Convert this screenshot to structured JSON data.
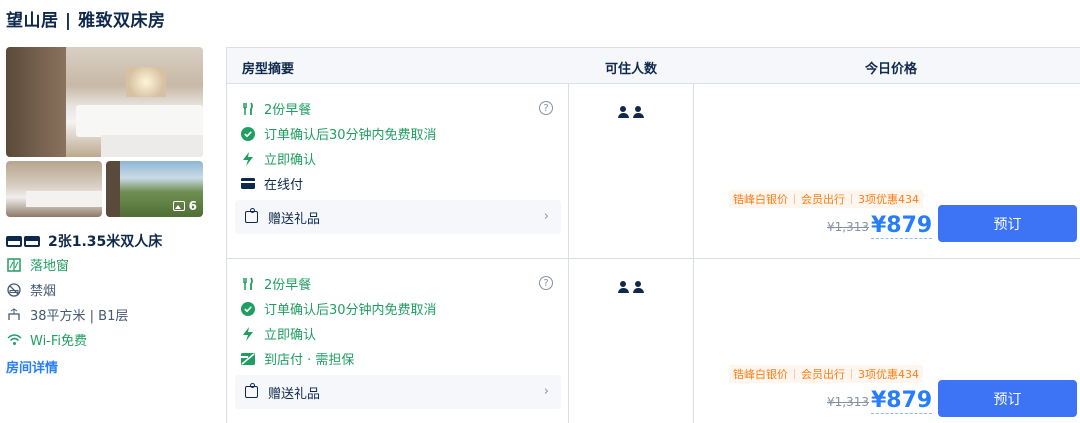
{
  "hotel_room_title": "望山居 | 雅致双床房",
  "photos": {
    "count": "6"
  },
  "room_info": {
    "bed": "2张1.35米双人床",
    "features": [
      {
        "icon": "window-icon",
        "text": "落地窗"
      },
      {
        "icon": "no-smoking-icon",
        "text": "禁烟"
      },
      {
        "icon": "area-icon",
        "text": "38平方米 | B1层"
      },
      {
        "icon": "wifi-icon",
        "text": "Wi-Fi免费"
      }
    ],
    "details_link": "房间详情"
  },
  "table": {
    "headers": {
      "summary": "房型摘要",
      "occupancy": "可住人数",
      "price": "今日价格"
    },
    "rows": [
      {
        "breakfast": "2份早餐",
        "cancel": "订单确认后30分钟内免费取消",
        "confirm": "立即确认",
        "payment": "在线付",
        "gift": "赠送礼品",
        "guests": 2,
        "tags": [
          "锆峰白银价",
          "会员出行",
          "3项优惠434"
        ],
        "original_price": "¥1,313",
        "price": "¥879",
        "book": "预订"
      },
      {
        "breakfast": "2份早餐",
        "cancel": "订单确认后30分钟内免费取消",
        "confirm": "立即确认",
        "payment": "到店付 · 需担保",
        "gift": "赠送礼品",
        "guests": 2,
        "tags": [
          "锆峰白银价",
          "会员出行",
          "3项优惠434"
        ],
        "original_price": "¥1,313",
        "price": "¥879",
        "book": "预订"
      }
    ]
  },
  "colors": {
    "accent": "#287dfa",
    "button": "#3d74f6",
    "green": "#1f9e61",
    "orange": "#ff7d13"
  }
}
